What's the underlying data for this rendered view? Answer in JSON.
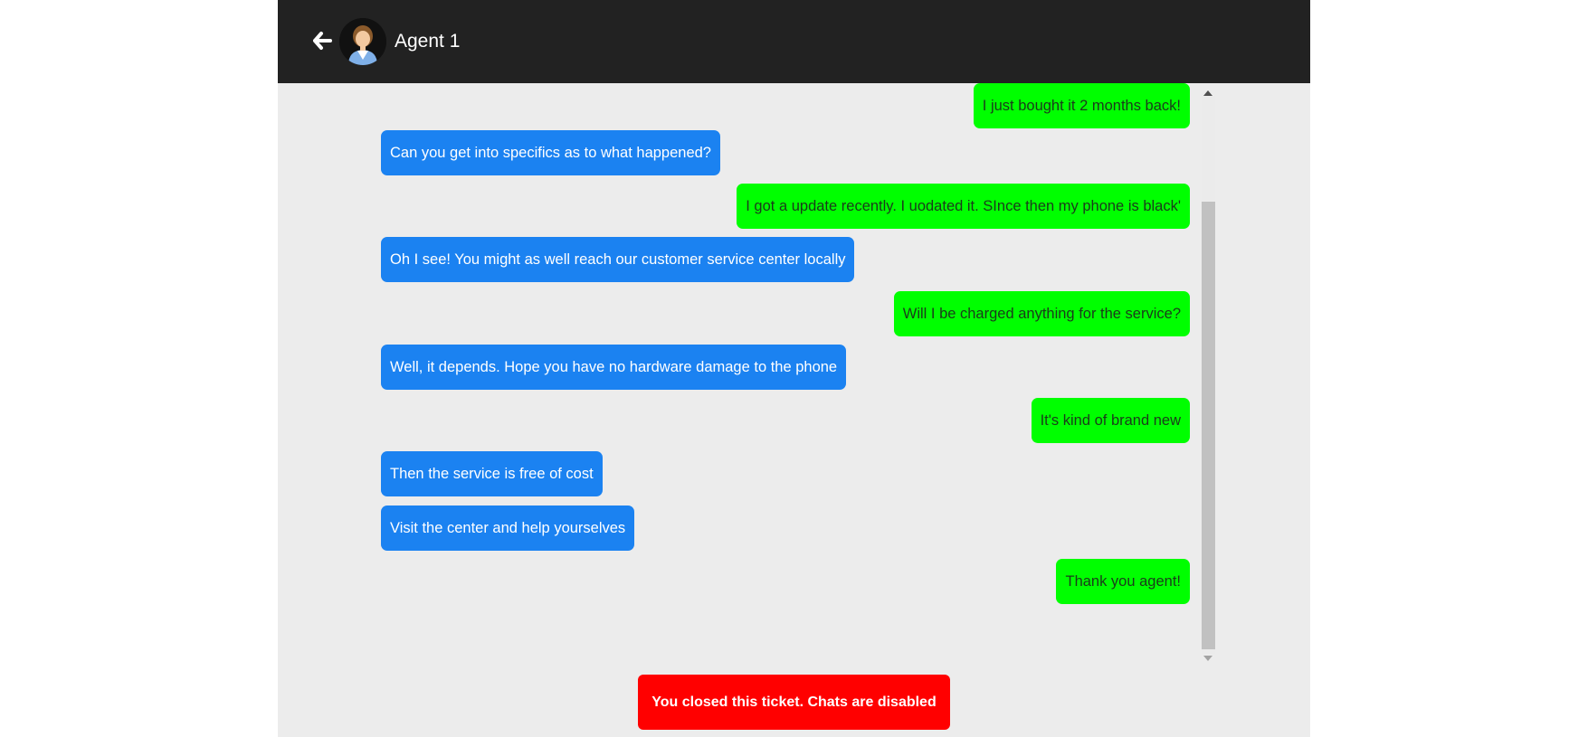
{
  "header": {
    "back_icon": "arrow-left-icon",
    "avatar_icon": "female-agent-avatar-icon",
    "agent_name": "Agent 1"
  },
  "colors": {
    "header_bg": "#222222",
    "agent_bubble": "#1b82f1",
    "user_bubble": "#00ff00",
    "chat_bg": "#ececec",
    "banner_bg": "#ff0000"
  },
  "messages": [
    {
      "sender": "user",
      "text": "I just bought it 2 months back!"
    },
    {
      "sender": "agent",
      "text": "Can you get into specifics as to what happened?"
    },
    {
      "sender": "user",
      "text": "I got a update recently. I uodated it. SInce then my phone is black'"
    },
    {
      "sender": "agent",
      "text": "Oh I see! You might as well reach our customer service center locally"
    },
    {
      "sender": "user",
      "text": "Will I be charged anything for the service?"
    },
    {
      "sender": "agent",
      "text": "Well, it depends. Hope you have no hardware damage to the phone"
    },
    {
      "sender": "user",
      "text": "It's kind of brand new"
    },
    {
      "sender": "agent",
      "text": "Then the service is free of cost"
    },
    {
      "sender": "agent",
      "text": "Visit the center and help yourselves"
    },
    {
      "sender": "user",
      "text": "Thank you agent!"
    }
  ],
  "banner": {
    "text": "You closed this ticket. Chats are disabled"
  }
}
